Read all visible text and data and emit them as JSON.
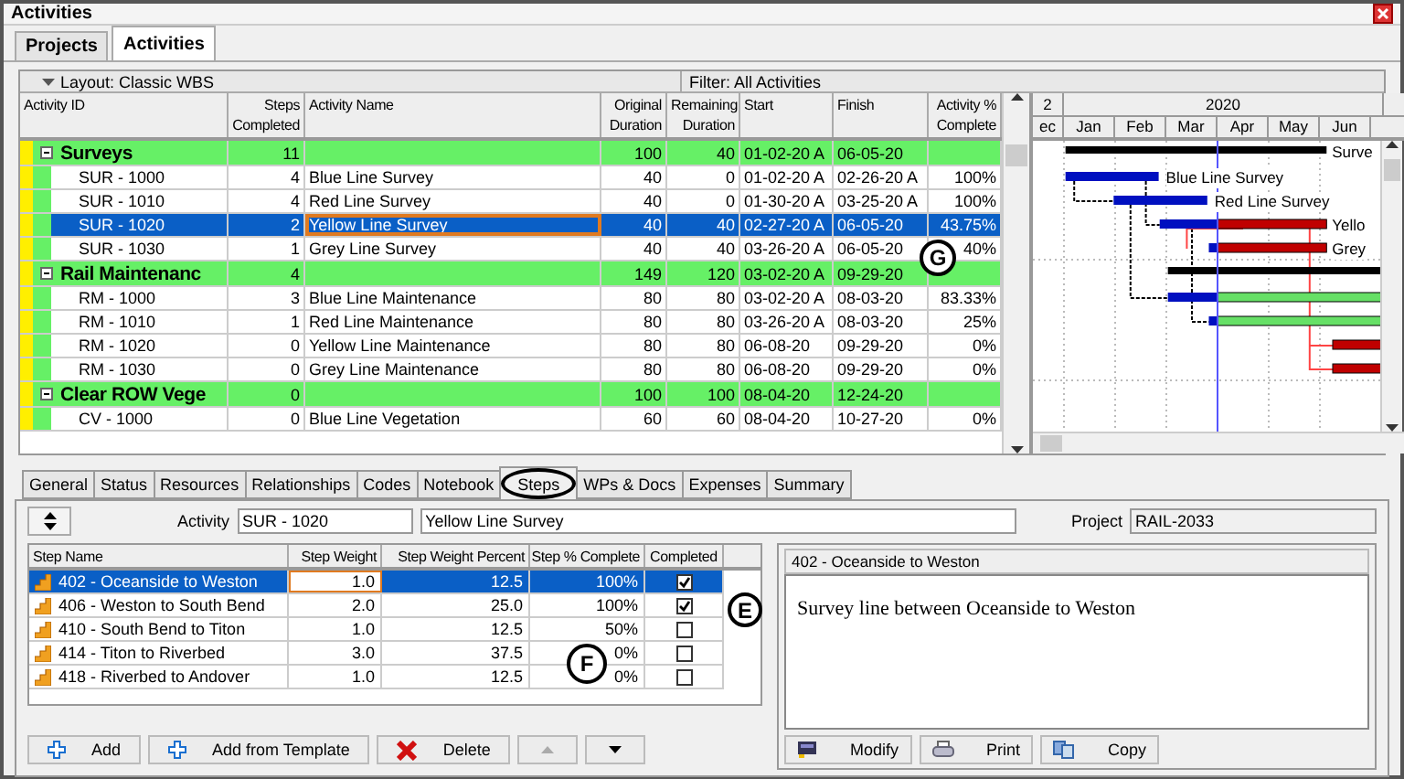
{
  "window": {
    "title": "Activities"
  },
  "top_tabs": [
    {
      "label": "Projects",
      "selected": false
    },
    {
      "label": "Activities",
      "selected": true
    }
  ],
  "layout_bar": {
    "layout": "Layout: Classic WBS",
    "filter": "Filter: All Activities"
  },
  "grid": {
    "columns": [
      "Activity ID",
      "Steps\nCompleted",
      "Activity Name",
      "Original\nDuration",
      "Remaining\nDuration",
      "Start",
      "Finish",
      "Activity %\nComplete"
    ],
    "rows": [
      {
        "kind": "wbs",
        "selected": false,
        "expanded": true,
        "id": "Surveys",
        "steps": "11",
        "orig": "100",
        "rem": "40",
        "start": "01-02-20 A",
        "finish": "06-05-20"
      },
      {
        "kind": "activity",
        "selected": false,
        "id": "SUR - 1000",
        "steps": "4",
        "name": "Blue Line Survey",
        "orig": "40",
        "rem": "0",
        "start": "01-02-20 A",
        "finish": "02-26-20 A",
        "pct": "100%"
      },
      {
        "kind": "activity",
        "selected": false,
        "id": "SUR - 1010",
        "steps": "4",
        "name": "Red Line Survey",
        "orig": "40",
        "rem": "0",
        "start": "01-30-20 A",
        "finish": "03-25-20 A",
        "pct": "100%"
      },
      {
        "kind": "activity",
        "selected": true,
        "id": "SUR - 1020",
        "steps": "2",
        "name": "Yellow Line Survey",
        "orig": "40",
        "rem": "40",
        "start": "02-27-20 A",
        "finish": "06-05-20",
        "pct": "43.75%"
      },
      {
        "kind": "activity",
        "selected": false,
        "id": "SUR - 1030",
        "steps": "1",
        "name": "Grey Line Survey",
        "orig": "40",
        "rem": "40",
        "start": "03-26-20 A",
        "finish": "06-05-20",
        "pct": "40%"
      },
      {
        "kind": "wbs",
        "selected": false,
        "expanded": true,
        "id": "Rail Maintenanc",
        "steps": "4",
        "orig": "149",
        "rem": "120",
        "start": "03-02-20 A",
        "finish": "09-29-20"
      },
      {
        "kind": "activity",
        "selected": false,
        "id": "RM - 1000",
        "steps": "3",
        "name": "Blue Line Maintenance",
        "orig": "80",
        "rem": "80",
        "start": "03-02-20 A",
        "finish": "08-03-20",
        "pct": "83.33%"
      },
      {
        "kind": "activity",
        "selected": false,
        "id": "RM - 1010",
        "steps": "1",
        "name": "Red Line Maintenance",
        "orig": "80",
        "rem": "80",
        "start": "03-26-20 A",
        "finish": "08-03-20",
        "pct": "25%"
      },
      {
        "kind": "activity",
        "selected": false,
        "id": "RM - 1020",
        "steps": "0",
        "name": "Yellow Line Maintenance",
        "orig": "80",
        "rem": "80",
        "start": "06-08-20",
        "finish": "09-29-20",
        "pct": "0%"
      },
      {
        "kind": "activity",
        "selected": false,
        "id": "RM - 1030",
        "steps": "0",
        "name": "Grey Line Maintenance",
        "orig": "80",
        "rem": "80",
        "start": "06-08-20",
        "finish": "09-29-20",
        "pct": "0%"
      },
      {
        "kind": "wbs",
        "selected": false,
        "expanded": true,
        "id": "Clear ROW Vege",
        "steps": "0",
        "orig": "100",
        "rem": "100",
        "start": "08-04-20",
        "finish": "12-24-20"
      },
      {
        "kind": "activity",
        "selected": false,
        "id": "CV - 1000",
        "steps": "0",
        "name": "Blue Line Vegetation",
        "orig": "60",
        "rem": "60",
        "start": "08-04-20",
        "finish": "10-27-20",
        "pct": "0%"
      }
    ]
  },
  "grid_callout": "G",
  "gantt": {
    "year_prev": "2",
    "year": "2020",
    "months": [
      "ec",
      "Jan",
      "Feb",
      "Mar",
      "Apr",
      "May",
      "Jun"
    ],
    "labels": [
      "Surve",
      "Blue Line Survey",
      "Red Line Survey",
      "Yello",
      "Grey"
    ]
  },
  "detail_tabs": [
    {
      "label": "General",
      "selected": false
    },
    {
      "label": "Status",
      "selected": false
    },
    {
      "label": "Resources",
      "selected": false
    },
    {
      "label": "Relationships",
      "selected": false
    },
    {
      "label": "Codes",
      "selected": false
    },
    {
      "label": "Notebook",
      "selected": false
    },
    {
      "label": "Steps",
      "selected": true,
      "circled": true
    },
    {
      "label": "WPs & Docs",
      "selected": false
    },
    {
      "label": "Expenses",
      "selected": false
    },
    {
      "label": "Summary",
      "selected": false
    }
  ],
  "activity_field": {
    "label": "Activity",
    "value": "SUR - 1020"
  },
  "activity_name": {
    "value": "Yellow Line Survey"
  },
  "project_field": {
    "label": "Project",
    "value": "RAIL-2033"
  },
  "steps": {
    "columns": [
      "Step Name",
      "Step Weight",
      "Step Weight Percent",
      "Step % Complete",
      "Completed"
    ],
    "rows": [
      {
        "name": "402 - Oceanside to Weston",
        "weight": "1.0",
        "percent": "12.5",
        "complete": "100%",
        "completed": true,
        "selected": true
      },
      {
        "name": "406 - Weston to South Bend",
        "weight": "2.0",
        "percent": "25.0",
        "complete": "100%",
        "completed": true,
        "selected": false
      },
      {
        "name": "410 - South Bend to Titon",
        "weight": "1.0",
        "percent": "12.5",
        "complete": "50%",
        "completed": false,
        "selected": false
      },
      {
        "name": "414 - Titon to Riverbed",
        "weight": "3.0",
        "percent": "37.5",
        "complete": "0%",
        "completed": false,
        "selected": false
      },
      {
        "name": "418 - Riverbed to Andover",
        "weight": "1.0",
        "percent": "12.5",
        "complete": "0%",
        "completed": false,
        "selected": false
      }
    ]
  },
  "steps_callouts": [
    "E",
    "F"
  ],
  "step_buttons": [
    {
      "kind": "add",
      "label": "Add"
    },
    {
      "kind": "add",
      "label": "Add from Template"
    },
    {
      "kind": "delete",
      "label": "Delete"
    },
    {
      "kind": "up",
      "disabled": true
    },
    {
      "kind": "down",
      "disabled": false
    }
  ],
  "notes": {
    "title": "402 - Oceanside to Weston",
    "text": "Survey line between Oceanside to Weston",
    "buttons": [
      {
        "kind": "modify",
        "label": "Modify"
      },
      {
        "kind": "print",
        "label": "Print"
      },
      {
        "kind": "copy",
        "label": "Copy"
      }
    ]
  }
}
